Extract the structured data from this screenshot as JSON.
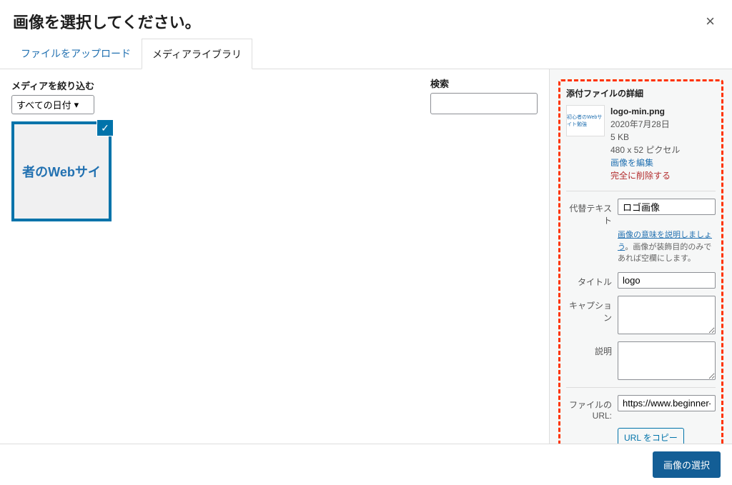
{
  "modal": {
    "title": "画像を選択してください。",
    "tabs": {
      "upload": "ファイルをアップロード",
      "library": "メディアライブラリ"
    }
  },
  "filters": {
    "media_label": "メディアを絞り込む",
    "date_value": "すべての日付",
    "search_label": "検索"
  },
  "thumb": {
    "preview_text": "者のWebサイ"
  },
  "details": {
    "title": "添付ファイルの詳細",
    "thumb_text": "初心者のWebサイト勉強",
    "filename": "logo-min.png",
    "date": "2020年7月28日",
    "filesize": "5 KB",
    "dimensions": "480 x 52 ピクセル",
    "edit_link": "画像を編集",
    "delete_link": "完全に削除する",
    "fields": {
      "alt_label": "代替テキスト",
      "alt_value": "ロゴ画像",
      "alt_help_link": "画像の意味を説明しましょう",
      "alt_help_text": "。画像が装飾目的のみであれば空欄にします。",
      "title_label": "タイトル",
      "title_value": "logo",
      "caption_label": "キャプション",
      "caption_value": "",
      "description_label": "説明",
      "description_value": "",
      "url_label": "ファイルの URL:",
      "url_value": "https://www.beginner-blog",
      "copy_url_btn": "URL をコピー"
    }
  },
  "footer": {
    "select_btn": "画像の選択"
  }
}
